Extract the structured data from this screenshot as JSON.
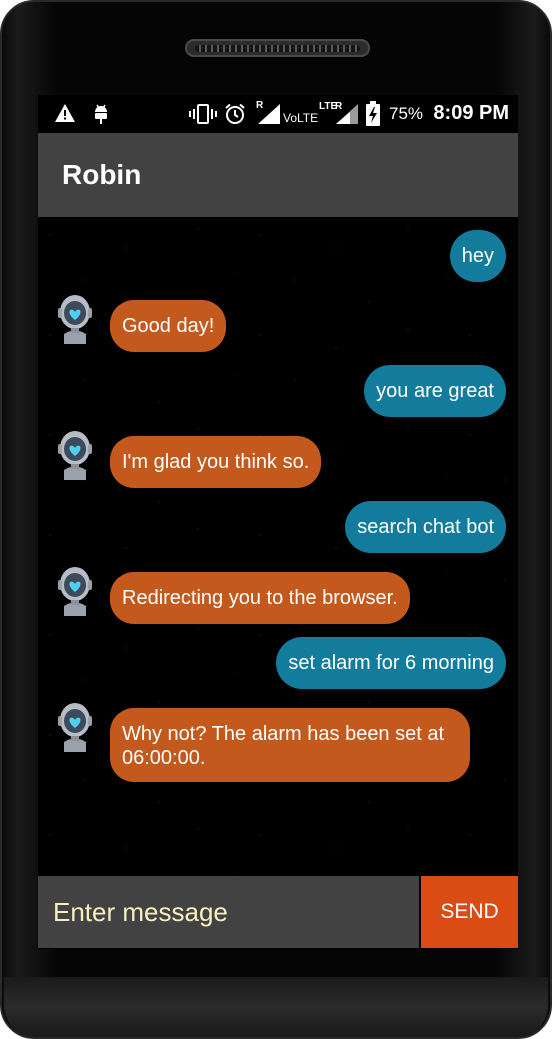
{
  "status_bar": {
    "battery": "75%",
    "time": "8:09 PM",
    "network_r": "R",
    "volte": "VoLTE",
    "lte": "LTE",
    "lte_r": "R"
  },
  "app_bar": {
    "title": "Robin"
  },
  "messages": [
    {
      "sender": "user",
      "text": "hey"
    },
    {
      "sender": "bot",
      "text": "Good day!"
    },
    {
      "sender": "user",
      "text": "you are great"
    },
    {
      "sender": "bot",
      "text": "I'm glad you think so."
    },
    {
      "sender": "user",
      "text": "search chat bot"
    },
    {
      "sender": "bot",
      "text": "Redirecting you to the browser."
    },
    {
      "sender": "user",
      "text": "set alarm for 6 morning"
    },
    {
      "sender": "bot",
      "text": "Why not? The alarm has been set at 06:00:00."
    }
  ],
  "composer": {
    "placeholder": "Enter message",
    "send_label": "SEND"
  },
  "colors": {
    "user_bubble": "#137b9c",
    "bot_bubble": "#c3591d",
    "send_button": "#db4b14",
    "app_bar": "#424242"
  }
}
